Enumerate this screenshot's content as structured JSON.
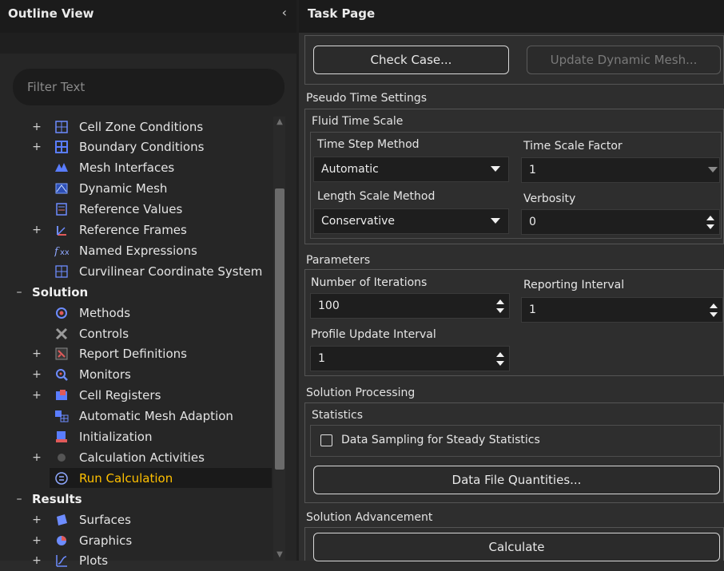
{
  "outline": {
    "title": "Outline View",
    "collapse_icon": "chevron-left-icon",
    "filter_placeholder": "Filter Text",
    "items": [
      {
        "label": "Cell Zone Conditions",
        "expander": "+",
        "icon": "cell-zone-icon",
        "indent": 1,
        "section": false
      },
      {
        "label": "Boundary Conditions",
        "expander": "+",
        "icon": "boundary-conditions-icon",
        "indent": 1,
        "section": false
      },
      {
        "label": "Mesh Interfaces",
        "expander": "",
        "icon": "mesh-interfaces-icon",
        "indent": 1,
        "section": false
      },
      {
        "label": "Dynamic Mesh",
        "expander": "",
        "icon": "dynamic-mesh-icon",
        "indent": 1,
        "section": false
      },
      {
        "label": "Reference Values",
        "expander": "",
        "icon": "reference-values-icon",
        "indent": 1,
        "section": false
      },
      {
        "label": "Reference Frames",
        "expander": "+",
        "icon": "reference-frames-icon",
        "indent": 1,
        "section": false
      },
      {
        "label": "Named Expressions",
        "expander": "",
        "icon": "named-expressions-icon",
        "indent": 1,
        "section": false
      },
      {
        "label": "Curvilinear Coordinate System",
        "expander": "",
        "icon": "curvilinear-coordinate-icon",
        "indent": 1,
        "section": false
      },
      {
        "label": "Solution",
        "expander": "-",
        "icon": "",
        "indent": 0,
        "section": true
      },
      {
        "label": "Methods",
        "expander": "",
        "icon": "methods-icon",
        "indent": 1,
        "section": false
      },
      {
        "label": "Controls",
        "expander": "",
        "icon": "controls-icon",
        "indent": 1,
        "section": false
      },
      {
        "label": "Report Definitions",
        "expander": "+",
        "icon": "report-definitions-icon",
        "indent": 1,
        "section": false
      },
      {
        "label": "Monitors",
        "expander": "+",
        "icon": "monitors-icon",
        "indent": 1,
        "section": false
      },
      {
        "label": "Cell Registers",
        "expander": "+",
        "icon": "cell-registers-icon",
        "indent": 1,
        "section": false
      },
      {
        "label": "Automatic Mesh Adaption",
        "expander": "",
        "icon": "mesh-adaption-icon",
        "indent": 1,
        "section": false
      },
      {
        "label": "Initialization",
        "expander": "",
        "icon": "initialization-icon",
        "indent": 1,
        "section": false
      },
      {
        "label": "Calculation Activities",
        "expander": "+",
        "icon": "calculation-activities-icon",
        "indent": 1,
        "section": false
      },
      {
        "label": "Run Calculation",
        "expander": "",
        "icon": "run-calculation-icon",
        "indent": 1,
        "section": false,
        "selected": true
      },
      {
        "label": "Results",
        "expander": "-",
        "icon": "",
        "indent": 0,
        "section": true
      },
      {
        "label": "Surfaces",
        "expander": "+",
        "icon": "surfaces-icon",
        "indent": 1,
        "section": false
      },
      {
        "label": "Graphics",
        "expander": "+",
        "icon": "graphics-icon",
        "indent": 1,
        "section": false
      },
      {
        "label": "Plots",
        "expander": "+",
        "icon": "plots-icon",
        "indent": 1,
        "section": false
      }
    ]
  },
  "task": {
    "title": "Task Page",
    "check_case_label": "Check Case...",
    "update_dynamic_mesh_label": "Update Dynamic Mesh...",
    "pseudo_time": {
      "section_label": "Pseudo Time Settings",
      "group_label": "Fluid Time Scale",
      "time_step_method_label": "Time Step Method",
      "time_step_method_value": "Automatic",
      "time_scale_factor_label": "Time Scale Factor",
      "time_scale_factor_value": "1",
      "length_scale_method_label": "Length Scale Method",
      "length_scale_method_value": "Conservative",
      "verbosity_label": "Verbosity",
      "verbosity_value": "0"
    },
    "parameters": {
      "section_label": "Parameters",
      "iterations_label": "Number of Iterations",
      "iterations_value": "100",
      "reporting_interval_label": "Reporting Interval",
      "reporting_interval_value": "1",
      "profile_update_label": "Profile Update Interval",
      "profile_update_value": "1"
    },
    "solution_processing": {
      "section_label": "Solution Processing",
      "statistics_label": "Statistics",
      "data_sampling_label": "Data Sampling for Steady Statistics",
      "data_sampling_checked": false,
      "data_file_quantities_label": "Data File Quantities..."
    },
    "solution_advancement": {
      "section_label": "Solution Advancement",
      "calculate_label": "Calculate"
    }
  }
}
